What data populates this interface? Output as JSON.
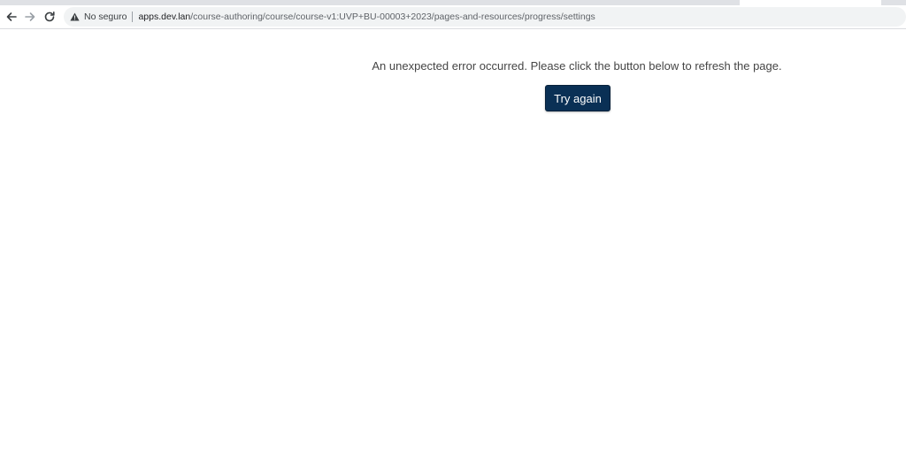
{
  "browser": {
    "nav": {
      "back_icon": "arrow-left-icon",
      "forward_icon": "arrow-right-icon",
      "reload_icon": "reload-icon"
    },
    "omnibox": {
      "warning_icon": "warning-triangle-icon",
      "security_label": "No seguro",
      "host": "apps.dev.lan",
      "path": "/course-authoring/course/course-v1:UVP+BU-00003+2023/pages-and-resources/progress/settings"
    }
  },
  "page": {
    "error_message": "An unexpected error occurred. Please click the button below to refresh the page.",
    "retry_button_label": "Try again"
  },
  "colors": {
    "primary_button": "#0a3055",
    "message_text": "#454545",
    "toolbar_bg": "#ffffff",
    "omnibox_bg": "#f1f3f4"
  }
}
